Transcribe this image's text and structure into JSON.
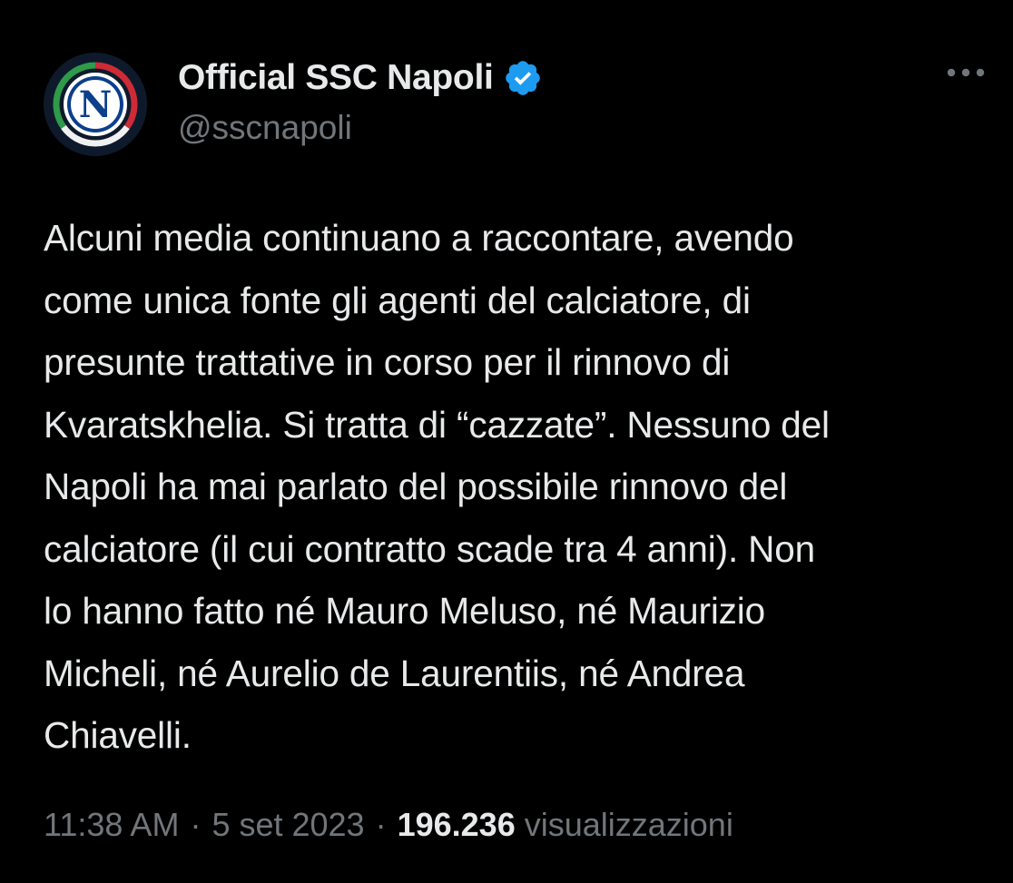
{
  "author": {
    "display_name": "Official SSC Napoli",
    "handle": "@sscnapoli",
    "verified": true,
    "avatar_icon": "ssc-napoli-logo-icon",
    "avatar_letter": "N"
  },
  "tweet": {
    "lines": [
      "Alcuni media continuano a raccontare, avendo",
      "come unica fonte gli agenti del calciatore, di",
      "presunte trattative in corso per il rinnovo di",
      "Kvaratskhelia. Si tratta di “cazzate”. Nessuno del",
      "Napoli ha mai parlato del possibile rinnovo del",
      "calciatore (il cui contratto scade tra 4 anni). Non",
      "lo hanno fatto né Mauro Meluso, né Maurizio",
      "Micheli, né Aurelio de Laurentiis, né Andrea",
      "Chiavelli."
    ]
  },
  "meta": {
    "time": "11:38 AM",
    "separator": "·",
    "date": "5 set 2023",
    "views_count": "196.236",
    "views_label": "visualizzazioni"
  },
  "icons": {
    "more": "more-horizontal-icon",
    "verified": "verified-badge-icon"
  },
  "colors": {
    "background": "#000000",
    "text_primary": "#e7e9ea",
    "text_secondary": "#71767b",
    "verified_blue": "#1d9bf0",
    "flag_green": "#2e9a4a",
    "flag_red": "#ce2b37"
  }
}
